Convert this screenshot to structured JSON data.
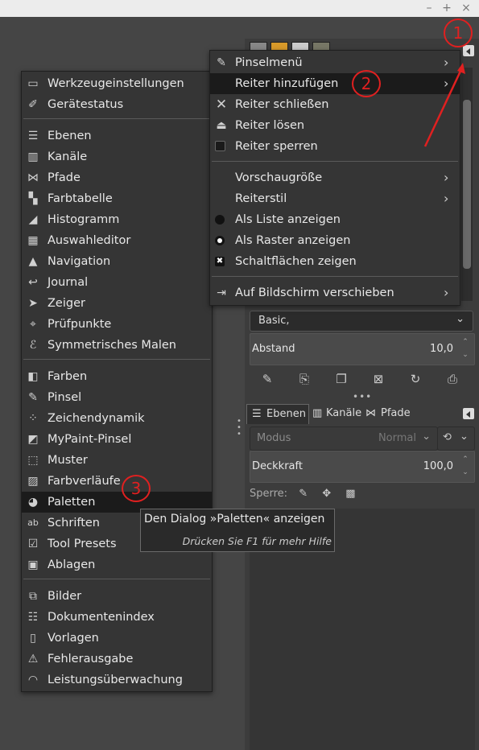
{
  "window": {
    "minimize": "–",
    "maximize": "+",
    "close": "×"
  },
  "tool_options": {
    "brush_combo": "Basic,",
    "spacing_label": "Abstand",
    "spacing_value": "10,0"
  },
  "layers_dock": {
    "tabs": [
      {
        "label": "Ebenen",
        "icon": "layers-icon"
      },
      {
        "label": "Kanäle",
        "icon": "channels-icon"
      },
      {
        "label": "Pfade",
        "icon": "paths-icon"
      }
    ],
    "mode_label": "Modus",
    "mode_value": "Normal",
    "opacity_label": "Deckkraft",
    "opacity_value": "100,0",
    "lock_label": "Sperre:"
  },
  "tab_menu": {
    "items": [
      {
        "label": "Pinselmenü",
        "icon": "brush-icon",
        "submenu": true
      },
      {
        "label": "Reiter hinzufügen",
        "icon": "",
        "submenu": true,
        "highlighted": true
      },
      {
        "label": "Reiter schließen",
        "icon": "close-icon",
        "submenu": false
      },
      {
        "label": "Reiter lösen",
        "icon": "eject-icon",
        "submenu": false
      },
      {
        "label": "Reiter sperren",
        "icon": "checkbox-icon",
        "submenu": false
      },
      {
        "label": "Vorschaugröße",
        "icon": "",
        "submenu": true
      },
      {
        "label": "Reiterstil",
        "icon": "",
        "submenu": true
      },
      {
        "label": "Als Liste anzeigen",
        "icon": "radio-filled-icon",
        "submenu": false
      },
      {
        "label": "Als Raster anzeigen",
        "icon": "radio-selected-icon",
        "submenu": false
      },
      {
        "label": "Schaltflächen zeigen",
        "icon": "checkbox-checked-icon",
        "submenu": false
      },
      {
        "label": "Auf Bildschirm verschieben",
        "icon": "move-screen-icon",
        "submenu": true
      }
    ]
  },
  "dialogs_menu": {
    "groups": [
      [
        {
          "label": "Werkzeugeinstellungen",
          "icon": "tool-options-icon"
        },
        {
          "label": "Gerätestatus",
          "icon": "device-status-icon"
        }
      ],
      [
        {
          "label": "Ebenen",
          "icon": "layers-icon"
        },
        {
          "label": "Kanäle",
          "icon": "channels-icon"
        },
        {
          "label": "Pfade",
          "icon": "paths-icon"
        },
        {
          "label": "Farbtabelle",
          "icon": "colormap-icon"
        },
        {
          "label": "Histogramm",
          "icon": "histogram-icon"
        },
        {
          "label": "Auswahleditor",
          "icon": "selection-editor-icon"
        },
        {
          "label": "Navigation",
          "icon": "navigation-icon"
        },
        {
          "label": "Journal",
          "icon": "undo-history-icon"
        },
        {
          "label": "Zeiger",
          "icon": "pointer-icon"
        },
        {
          "label": "Prüfpunkte",
          "icon": "sample-points-icon"
        },
        {
          "label": "Symmetrisches Malen",
          "icon": "symmetry-icon"
        }
      ],
      [
        {
          "label": "Farben",
          "icon": "colors-icon"
        },
        {
          "label": "Pinsel",
          "icon": "brush-icon"
        },
        {
          "label": "Zeichendynamik",
          "icon": "dynamics-icon"
        },
        {
          "label": "MyPaint-Pinsel",
          "icon": "mypaint-brush-icon"
        },
        {
          "label": "Muster",
          "icon": "pattern-icon"
        },
        {
          "label": "Farbverläufe",
          "icon": "gradient-icon"
        },
        {
          "label": "Paletten",
          "icon": "palette-icon",
          "highlighted": true
        },
        {
          "label": "Schriften",
          "icon": "fonts-icon"
        },
        {
          "label": "Tool Presets",
          "icon": "tool-presets-icon"
        },
        {
          "label": "Ablagen",
          "icon": "buffers-icon"
        }
      ],
      [
        {
          "label": "Bilder",
          "icon": "images-icon"
        },
        {
          "label": "Dokumentenindex",
          "icon": "document-history-icon"
        },
        {
          "label": "Vorlagen",
          "icon": "templates-icon"
        },
        {
          "label": "Fehlerausgabe",
          "icon": "error-console-icon"
        },
        {
          "label": "Leistungsüberwachung",
          "icon": "dashboard-icon"
        }
      ]
    ]
  },
  "tooltip": {
    "line1": "Den Dialog »Paletten« anzeigen",
    "line2": "Drücken Sie F1 für mehr Hilfe"
  },
  "annotations": [
    {
      "number": "1",
      "color": "#e02020"
    },
    {
      "number": "2",
      "color": "#e02020"
    },
    {
      "number": "3",
      "color": "#e02020"
    }
  ]
}
